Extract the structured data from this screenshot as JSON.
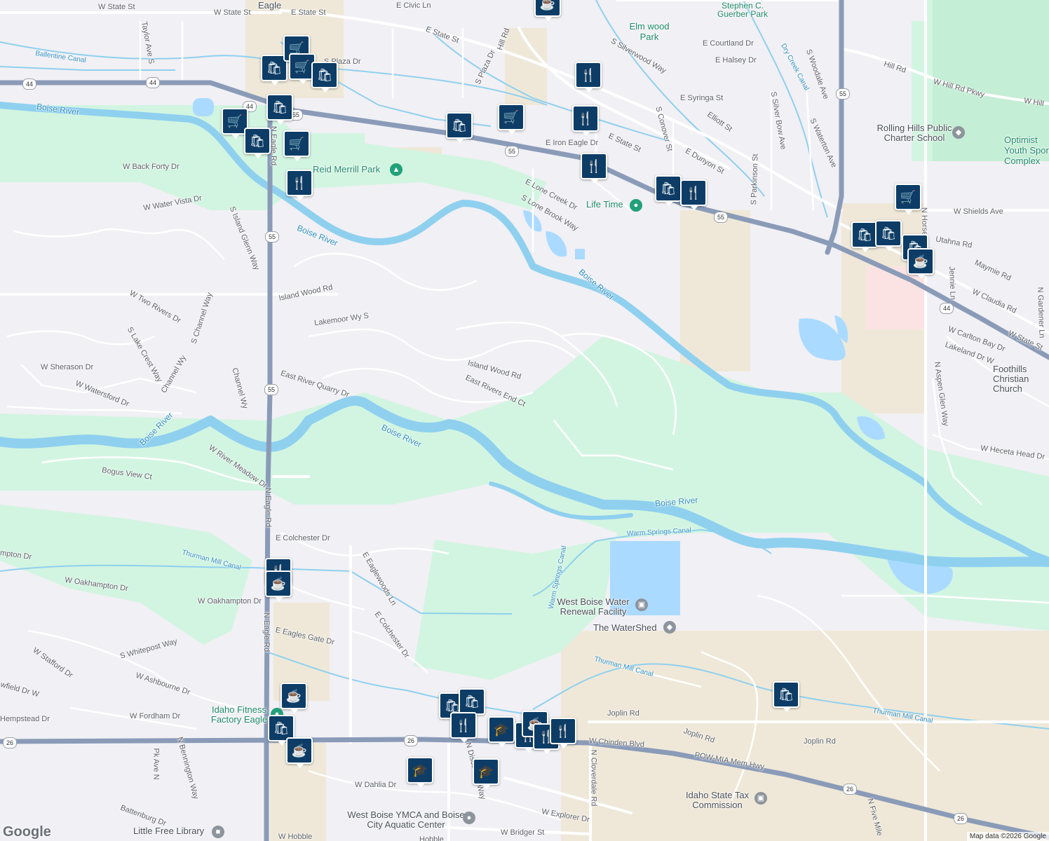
{
  "map": {
    "logo": "Google",
    "attribution": "Map data ©2026 Google",
    "roads": [
      "W State St",
      "W State St",
      "E State St",
      "E State St",
      "E State St",
      "W State St",
      "E Civic Ln",
      "Hill Rd",
      "Hill Rd",
      "W Hill Rd Pkwy",
      "W Hill",
      "S Plaza Dr",
      "S Plaza Dr",
      "Taylor Ave S",
      "S Silverwood Way",
      "E Courtland Dr",
      "E Halsey Dr",
      "E Syringa St",
      "Elliott St",
      "S Conover St",
      "E Iron Eagle Dr",
      "E Dunyon St",
      "S Parkinson St",
      "S Silver Bow Ave",
      "S Woodale Ave",
      "S Waterton Ave",
      "W Shields Ave",
      "Utahna Rd",
      "Maymie Rd",
      "W Claudia Rd",
      "W Carlton Bay Dr",
      "Lakeland Dr W",
      "Jennie Ln",
      "N Gardener Ln",
      "N Horse",
      "E Lone Creek Dr",
      "S Lone Brook Way",
      "W Back Forty Dr",
      "W Water Vista Dr",
      "S Island Glenn Way",
      "Island Wood Rd",
      "Island Wood Rd",
      "W Two Rivers Dr",
      "S Channel Way",
      "Lakemoor Wy S",
      "S Lake Crest Way",
      "W Sherason Dr",
      "W Watersford Dr",
      "Channel Wy",
      "Channel Wy",
      "East River Quarry Dr",
      "East Rivers End Ct",
      "Bogus View Ct",
      "W River Meadow Dr",
      "N Eagle Rd",
      "N Eagle Rd",
      "N Eagle Rd",
      "E Colchester Dr",
      "E Colchester Dr",
      "E Eaglewoods Ln",
      "W Oakhampton Dr",
      "W Oakhampton Dr",
      "E Eagles Gate Dr",
      "S Whitepost Way",
      "W Stafford Dr",
      "W Ashbourne Dr",
      "W Fordham Dr",
      "Hempstead Dr",
      "wfield Dr W",
      "mpton Dr",
      "Pk Ave N",
      "N Bennington Way",
      "Battenburg Dr",
      "W Hobble",
      "W Dahlia Dr",
      "N Discovery Way",
      "W Explorer Dr",
      "W Bridger St",
      "N Cloverdale Rd",
      "W Chinden Blvd",
      "POW-MIA Mem Hwy",
      "Joplin Rd",
      "Joplin Rd",
      "Joplin Rd",
      "N Five Mile",
      "N Aspen Glen Way",
      "W Hecetа Head Dr",
      "Hobble"
    ],
    "water": [
      "Boise River",
      "Boise River",
      "Boise River",
      "Boise River",
      "Boise River",
      "Boise River",
      "Ballentine Canal",
      "Dry Creek Canal",
      "Thurman Mill Canal",
      "Warm Springs Canal",
      "Warm Springs Canal",
      "Thurman Mill Canal",
      "Thurman Mill Canal"
    ],
    "places": [
      "Eagle",
      "Stephen C. Guerber Park",
      "Elm wood Park",
      "Reid Merrill Park",
      "Life Time",
      "Rolling Hills Public Charter School",
      "Optimist Youth Sports Complex",
      "Foothills Christian Church",
      "West Boise Water Renewal Facility",
      "The WaterShed",
      "Idaho Fitness Factory Eagle",
      "Idaho State Tax Commission",
      "West Boise YMCA and Boise City Aquatic Center",
      "Little Free Library"
    ],
    "shields": [
      "44",
      "44",
      "55",
      "55",
      "55",
      "55",
      "55",
      "55",
      "44",
      "44",
      "26",
      "26",
      "26",
      "26"
    ],
    "pins": {
      "shopping": "🛍",
      "grocery": "🛒",
      "restaurant": "🍴",
      "cafe": "☕",
      "school": "🎓"
    }
  }
}
